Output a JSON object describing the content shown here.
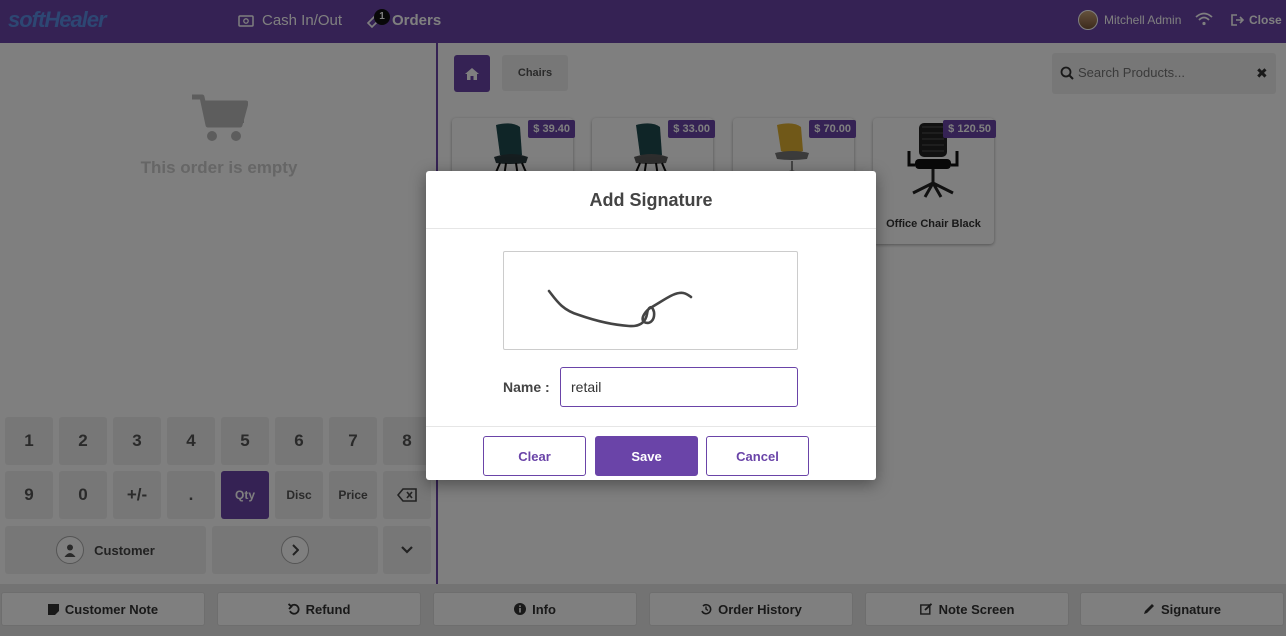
{
  "topbar": {
    "logo": "softHealer",
    "cash_label": "Cash In/Out",
    "orders_label": "Orders",
    "orders_badge": "1",
    "user_name": "Mitchell Admin",
    "close_label": "Close"
  },
  "left": {
    "empty_text": "This order is empty",
    "keys_row1": [
      "1",
      "2",
      "3",
      "4",
      "5",
      "6",
      "7",
      "8"
    ],
    "keys_row2": [
      "9",
      "0",
      "+/-",
      ".",
      "Qty",
      "Disc",
      "Price"
    ],
    "customer_label": "Customer"
  },
  "right": {
    "breadcrumb": "Chairs",
    "search_placeholder": "Search Products...",
    "products": [
      {
        "price": "$ 39.40",
        "name": ""
      },
      {
        "price": "$ 33.00",
        "name": ""
      },
      {
        "price": "$ 70.00",
        "name": ""
      },
      {
        "price": "$ 120.50",
        "name": "Office Chair Black"
      }
    ]
  },
  "bottom": {
    "buttons": [
      "Customer Note",
      "Refund",
      "Info",
      "Order History",
      "Note Screen",
      "Signature"
    ]
  },
  "modal": {
    "title": "Add Signature",
    "name_label": "Name :",
    "name_value": "retail",
    "clear_label": "Clear",
    "save_label": "Save",
    "cancel_label": "Cancel"
  },
  "colors": {
    "accent": "#6a44a8",
    "topbar": "#6a44a8"
  }
}
